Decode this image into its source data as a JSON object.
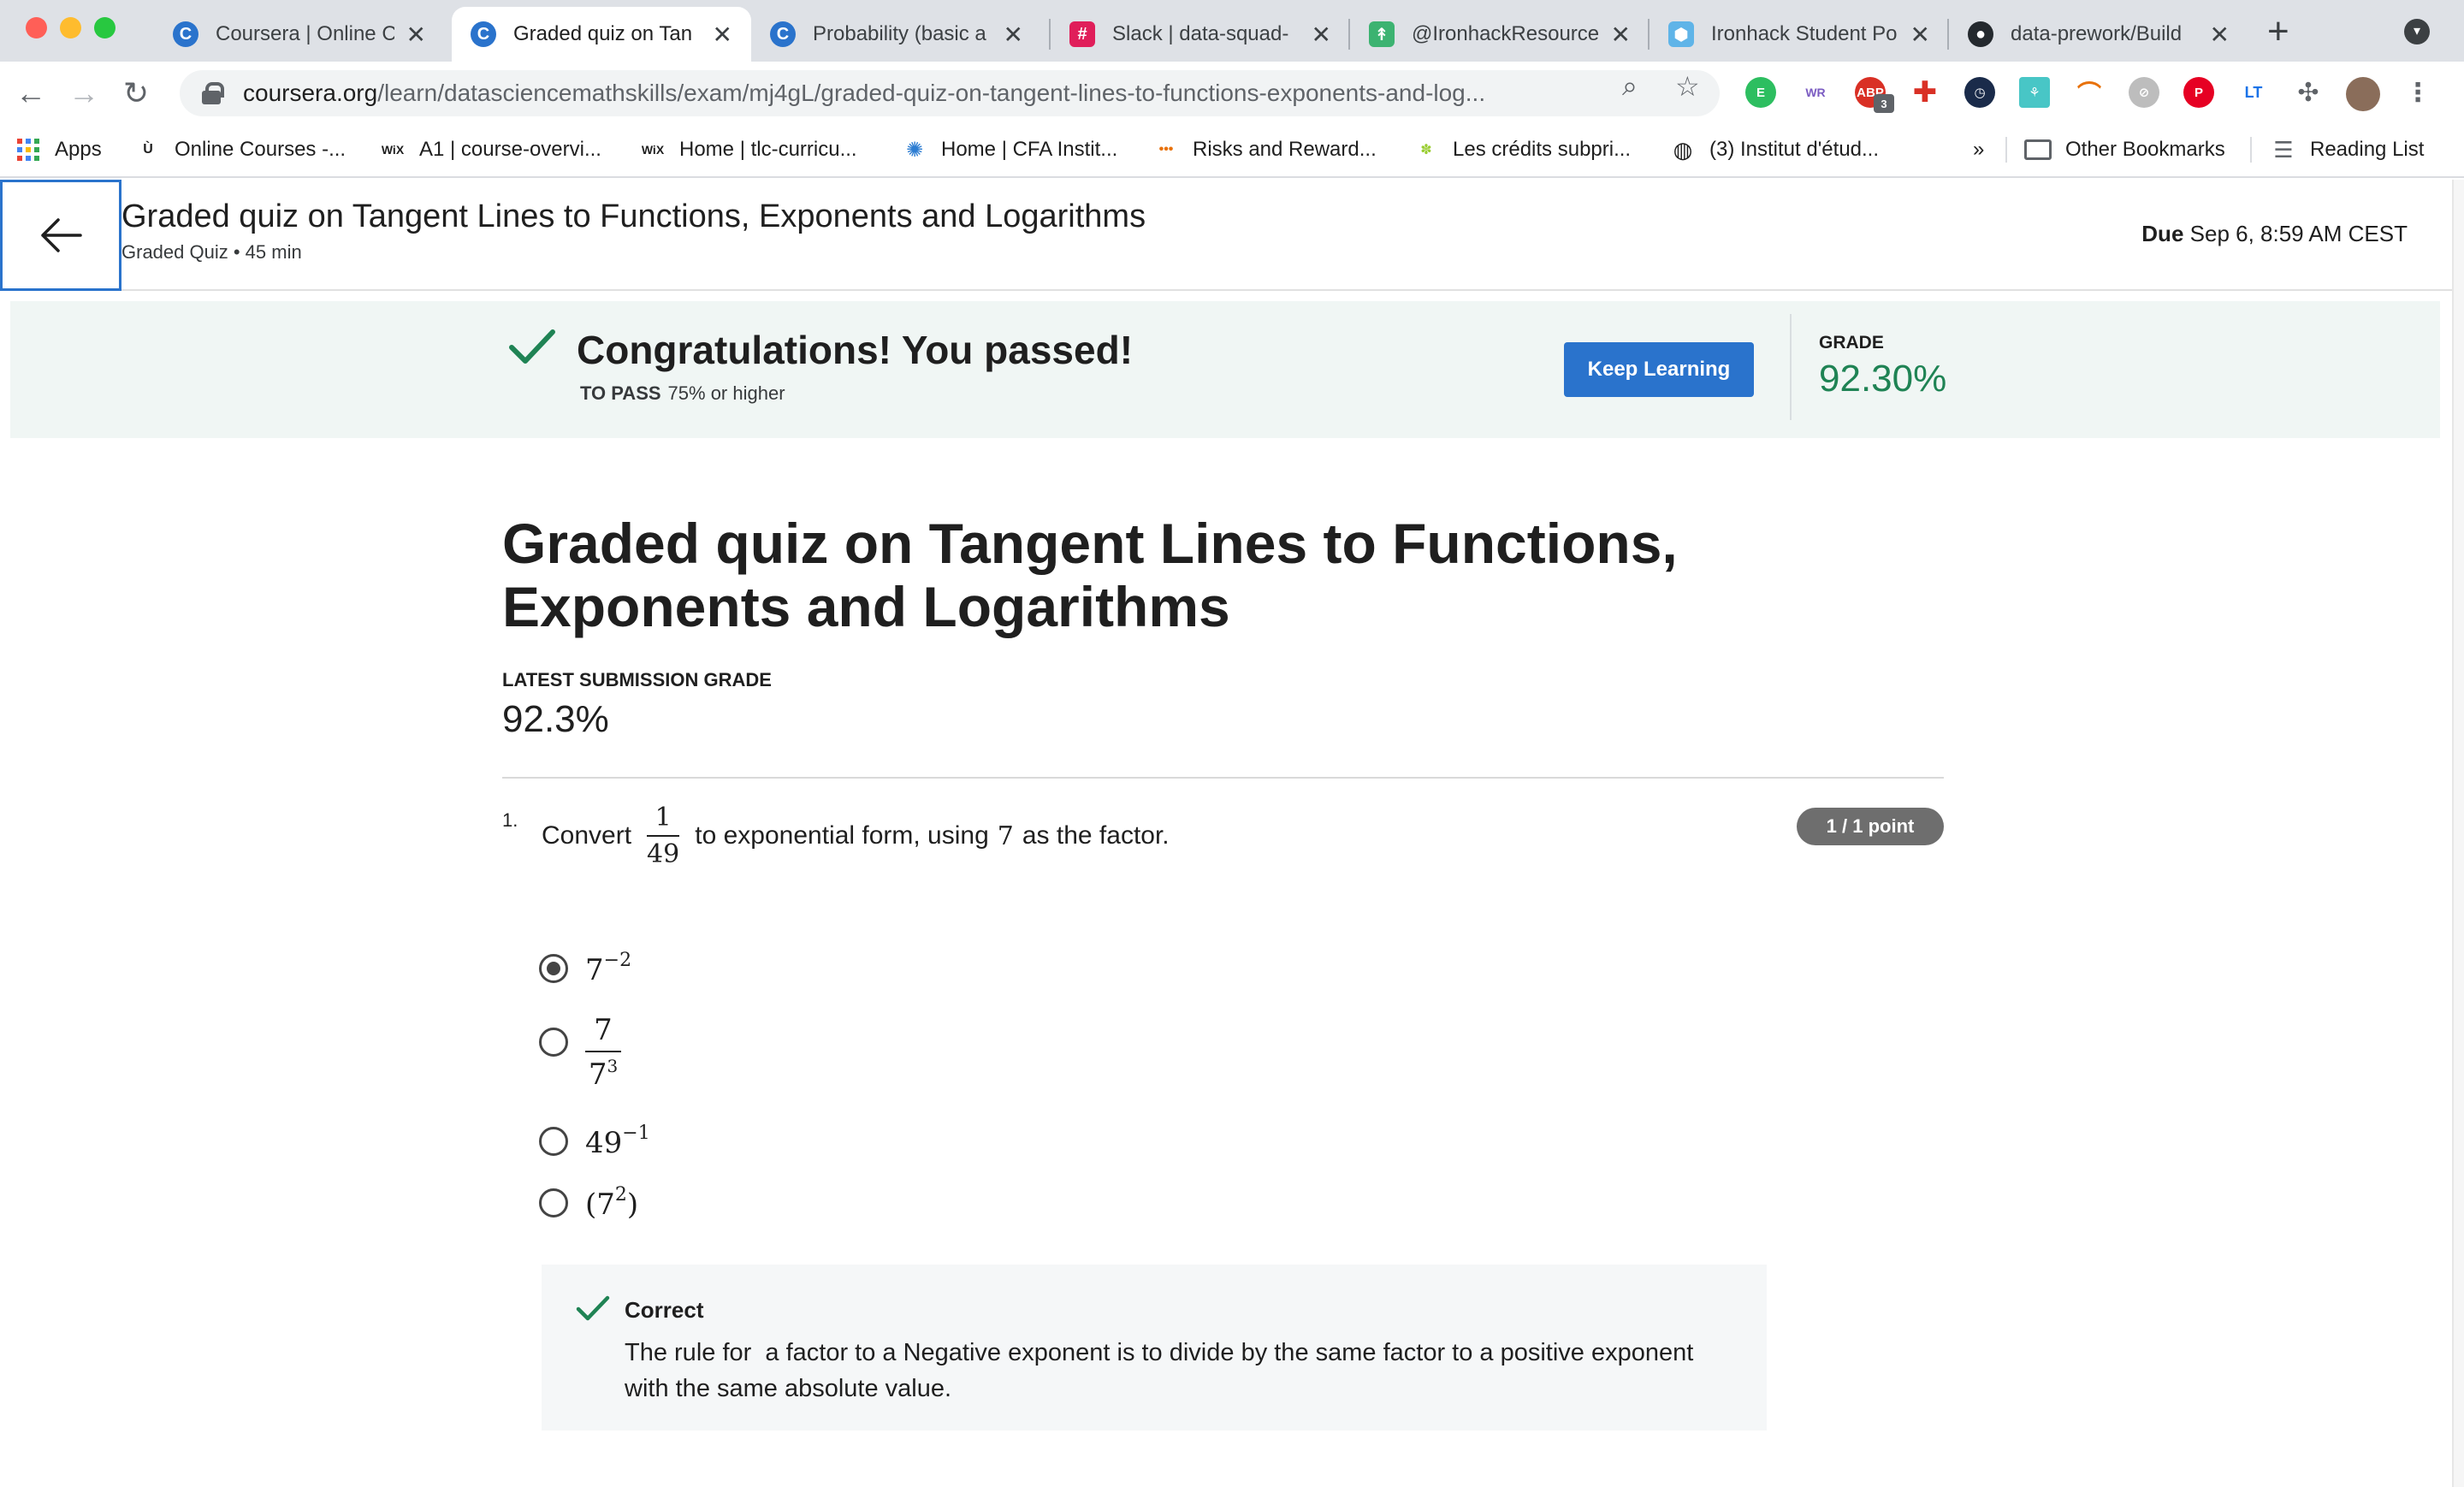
{
  "browser": {
    "tabs": [
      {
        "title": "Coursera | Online C",
        "favicon": "coursera-icon",
        "color": "#2a73cc",
        "glyph": "C",
        "active": false
      },
      {
        "title": "Graded quiz on Tan",
        "favicon": "coursera-icon",
        "color": "#2a73cc",
        "glyph": "C",
        "active": true
      },
      {
        "title": "Probability (basic a",
        "favicon": "coursera-icon",
        "color": "#2a73cc",
        "glyph": "C",
        "active": false
      },
      {
        "title": "Slack | data-squad-",
        "favicon": "slack-icon",
        "color": "#e01e5a",
        "glyph": "#",
        "active": false
      },
      {
        "title": "@IronhackResource",
        "favicon": "ironhack-icon",
        "color": "#3cb371",
        "glyph": "↟",
        "active": false
      },
      {
        "title": "Ironhack Student Po",
        "favicon": "ironhack-portal-icon",
        "color": "#5fb4e8",
        "glyph": "⬢",
        "active": false
      },
      {
        "title": "data-prework/Build",
        "favicon": "github-icon",
        "color": "#24292e",
        "glyph": "●",
        "active": false
      }
    ],
    "close_glyph": "✕",
    "new_tab_glyph": "+",
    "url_host": "coursera.org",
    "url_path": "/learn/datasciencemathskills/exam/mj4gL/graded-quiz-on-tangent-lines-to-functions-exponents-and-log...",
    "extension_badge": "3",
    "bookmarks": [
      {
        "label": "Apps",
        "icon": "apps-grid-icon"
      },
      {
        "label": "Online Courses -...",
        "icon": "udemy-icon",
        "glyph": "Ù"
      },
      {
        "label": "A1 | course-overvi...",
        "icon": "wix-icon",
        "glyph": "WiX"
      },
      {
        "label": "Home | tlc-curricu...",
        "icon": "wix-icon",
        "glyph": "WiX"
      },
      {
        "label": "Home | CFA Instit...",
        "icon": "cfa-icon",
        "glyph": "✺"
      },
      {
        "label": "Risks and Reward...",
        "icon": "risks-icon",
        "glyph": "•••"
      },
      {
        "label": "Les crédits subpri...",
        "icon": "palm-icon",
        "glyph": "🌴"
      },
      {
        "label": "(3) Institut d'étud...",
        "icon": "globe-icon",
        "glyph": "◍"
      }
    ],
    "more_bookmarks": "»",
    "other_bookmarks": "Other Bookmarks",
    "reading_list": "Reading List"
  },
  "header": {
    "title": "Graded quiz on Tangent Lines to Functions, Exponents and Logarithms",
    "subtitle": "Graded Quiz • 45 min",
    "due_label": "Due",
    "due_value": "Sep 6, 8:59 AM CEST"
  },
  "banner": {
    "title": "Congratulations! You passed!",
    "to_pass_label": "TO PASS",
    "to_pass_value": "75% or higher",
    "button": "Keep Learning",
    "grade_label": "GRADE",
    "grade_value": "92.30%"
  },
  "quiz": {
    "title": "Graded quiz on Tangent Lines to Functions, Exponents and Logarithms",
    "latest_label": "LATEST SUBMISSION GRADE",
    "latest_value": "92.3%"
  },
  "question": {
    "number": "1.",
    "prefix": "Convert",
    "frac_num": "1",
    "frac_den": "49",
    "middle": "to exponential form, using",
    "factor": "7",
    "suffix": "as the factor.",
    "points": "1 / 1 point",
    "options": [
      {
        "base": "7",
        "exp": "−2",
        "selected": true
      },
      {
        "num": "7",
        "den_base": "7",
        "den_exp": "3",
        "selected": false
      },
      {
        "base": "49",
        "exp": "−1",
        "selected": false
      },
      {
        "open": "(",
        "base": "7",
        "exp": "2",
        "close": ")",
        "selected": false
      }
    ]
  },
  "feedback": {
    "status": "Correct",
    "text": "The rule for  a factor to a Negative exponent is to divide by the same factor to a positive exponent with the same absolute value."
  },
  "colors": {
    "accent": "#2a73cc",
    "success": "#1f8354",
    "banner_bg": "#f0f6f4"
  }
}
